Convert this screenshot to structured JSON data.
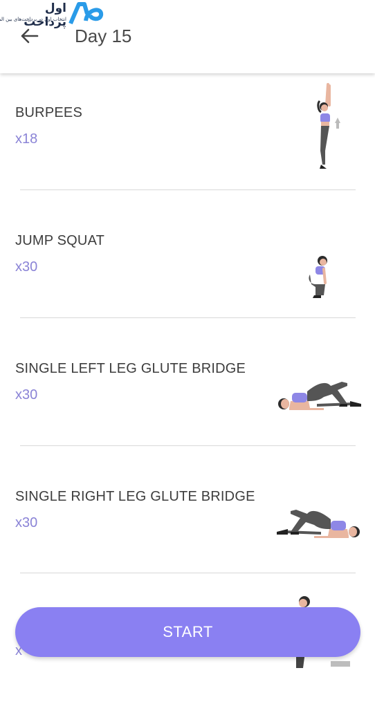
{
  "watermark": {
    "brand_text": "اول پرداخت",
    "tagline": "انتخاب اول در پرداخت‌های بین المللی"
  },
  "header": {
    "title": "Day 15",
    "back_icon": "arrow-left-icon"
  },
  "exercises": [
    {
      "name": "BURPEES",
      "reps": "x18"
    },
    {
      "name": "JUMP SQUAT",
      "reps": "x30"
    },
    {
      "name": "SINGLE LEFT LEG GLUTE BRIDGE",
      "reps": "x30"
    },
    {
      "name": "SINGLE RIGHT LEG GLUTE BRIDGE",
      "reps": "x30"
    },
    {
      "name": "",
      "reps": "x"
    }
  ],
  "start_button": {
    "label": "START"
  },
  "colors": {
    "accent": "#8a80f2",
    "reps_text": "#8a83d6",
    "title_text": "#4a4a4a",
    "outfit_top": "#8e87e6",
    "outfit_pants": "#555555"
  }
}
